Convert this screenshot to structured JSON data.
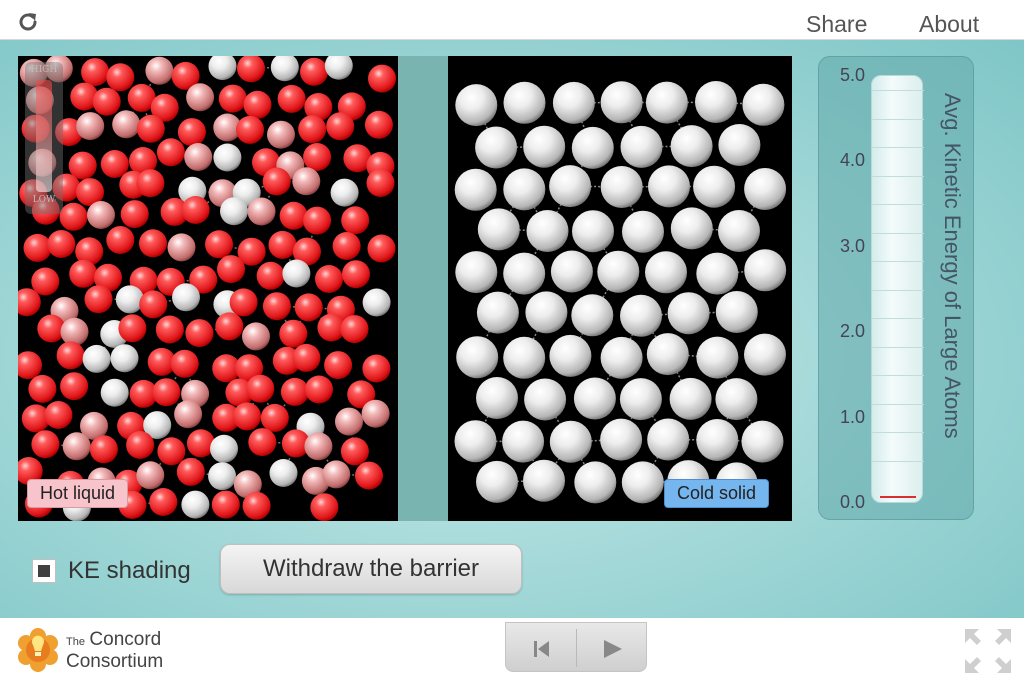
{
  "topbar": {
    "reload_icon": "reload-icon",
    "share_label": "Share",
    "about_label": "About"
  },
  "simulation": {
    "hot_label": "Hot liquid",
    "cold_label": "Cold solid",
    "ke_scale": {
      "high_label": "HIGH",
      "low_label": "LOW"
    },
    "colors": {
      "hot": "#ff3b3b",
      "cold": "#e8e8e8",
      "barrier": "#7ab4b1",
      "background": "#000000"
    }
  },
  "thermometer": {
    "title": "Avg. Kinetic Energy of Large Atoms",
    "ticks": [
      "5.0",
      "4.0",
      "3.0",
      "2.0",
      "1.0",
      "0.0"
    ],
    "value": 0.0,
    "max": 5.0
  },
  "controls": {
    "ke_shading_label": "KE shading",
    "ke_shading_checked": true,
    "withdraw_label": "Withdraw the barrier"
  },
  "footer": {
    "logo_the": "The",
    "logo_line1": "Concord",
    "logo_line2": "Consortium",
    "reset_icon": "skip-back-icon",
    "play_icon": "play-icon",
    "fullscreen_icon": "fullscreen-icon"
  }
}
